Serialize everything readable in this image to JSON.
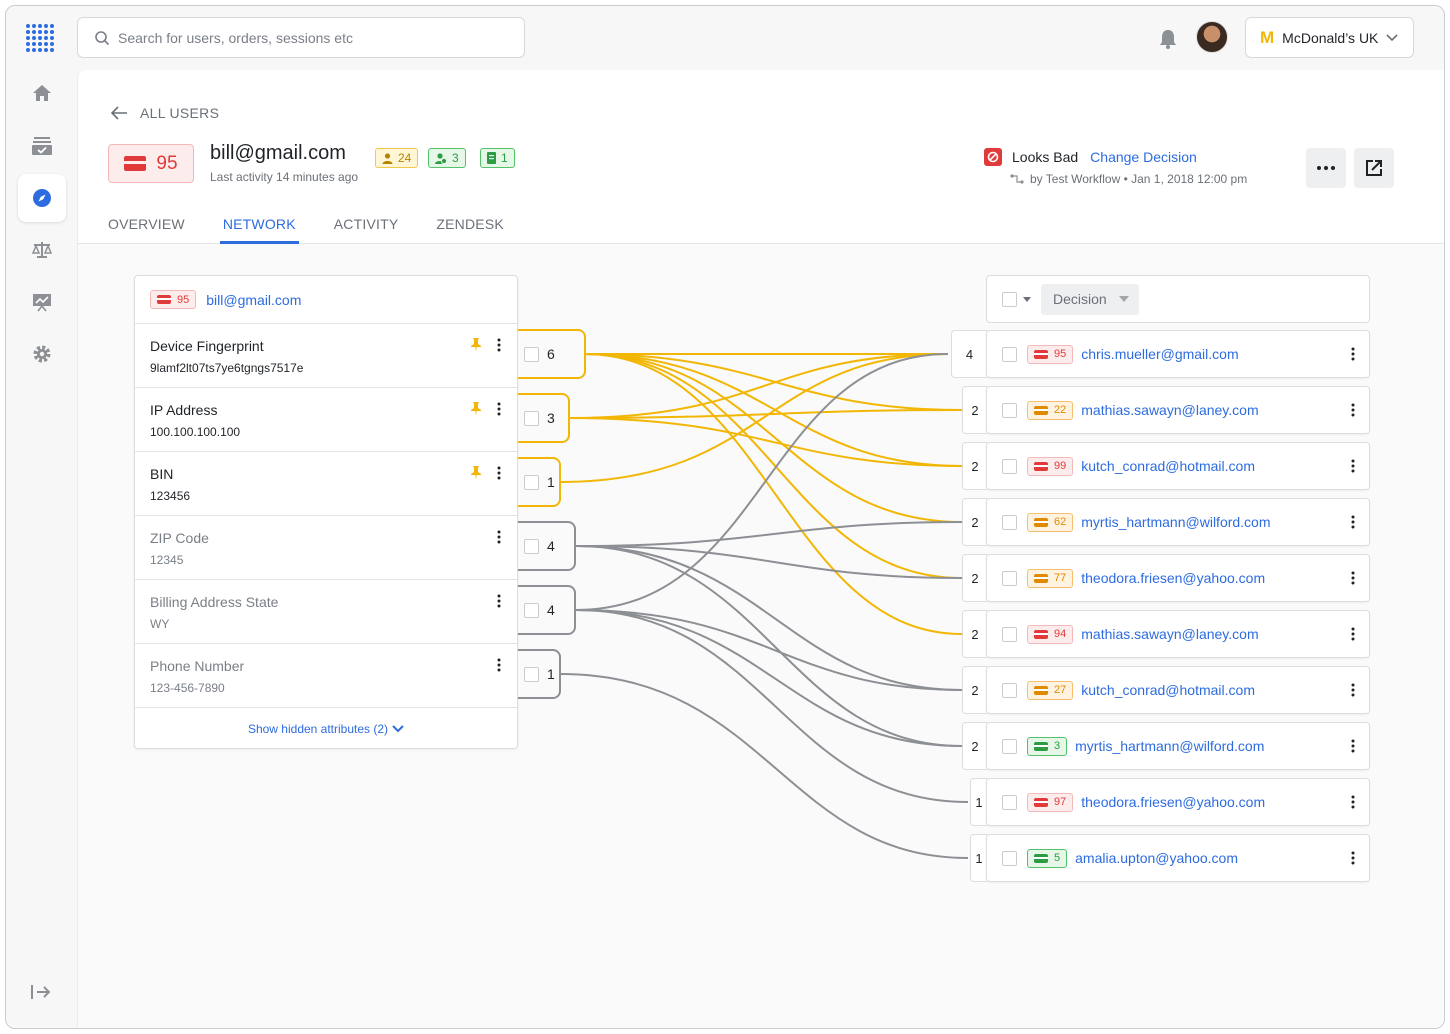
{
  "search": {
    "placeholder": "Search for users, orders, sessions etc"
  },
  "org": {
    "name": "McDonald’s UK"
  },
  "header": {
    "back_label": "ALL USERS",
    "score": "95",
    "user_email": "bill@gmail.com",
    "last_activity": "Last activity 14 minutes ago",
    "chips": [
      "24",
      "3",
      "1"
    ],
    "decision": "Looks Bad",
    "change_decision": "Change Decision",
    "byline": "by Test Workflow • Jan 1, 2018 12:00 pm",
    "tabs": [
      "OVERVIEW",
      "NETWORK",
      "ACTIVITY",
      "ZENDESK"
    ]
  },
  "panel": {
    "score": "95",
    "email": "bill@gmail.com",
    "attributes": [
      {
        "label": "Device Fingerprint",
        "value": "9lamf2lt07ts7ye6tgngs7517e",
        "pinned": true
      },
      {
        "label": "IP Address",
        "value": "100.100.100.100",
        "pinned": true
      },
      {
        "label": "BIN",
        "value": "123456",
        "pinned": true
      },
      {
        "label": "ZIP Code",
        "value": "12345",
        "pinned": false
      },
      {
        "label": "Billing Address State",
        "value": "WY",
        "pinned": false
      },
      {
        "label": "Phone Number",
        "value": "123-456-7890",
        "pinned": false
      }
    ],
    "show_hidden": "Show hidden attributes (2)"
  },
  "connectors": [
    "6",
    "3",
    "1",
    "4",
    "4",
    "1"
  ],
  "list_header": {
    "decision_label": "Decision"
  },
  "users": [
    {
      "count": "4",
      "score": "95",
      "email": "chris.mueller@gmail.com",
      "level": "red"
    },
    {
      "count": "2",
      "score": "22",
      "email": "mathias.sawayn@laney.com",
      "level": "orange"
    },
    {
      "count": "2",
      "score": "99",
      "email": "kutch_conrad@hotmail.com",
      "level": "red"
    },
    {
      "count": "2",
      "score": "62",
      "email": "myrtis_hartmann@wilford.com",
      "level": "orange"
    },
    {
      "count": "2",
      "score": "77",
      "email": "theodora.friesen@yahoo.com",
      "level": "orange"
    },
    {
      "count": "2",
      "score": "94",
      "email": "mathias.sawayn@laney.com",
      "level": "red"
    },
    {
      "count": "2",
      "score": "27",
      "email": "kutch_conrad@hotmail.com",
      "level": "orange"
    },
    {
      "count": "2",
      "score": "3",
      "email": "myrtis_hartmann@wilford.com",
      "level": "green"
    },
    {
      "count": "1",
      "score": "97",
      "email": "theodora.friesen@yahoo.com",
      "level": "red"
    },
    {
      "count": "1",
      "score": "5",
      "email": "amalia.upton@yahoo.com",
      "level": "green"
    }
  ],
  "colors": {
    "accent": "#2d6cdf",
    "link_yellow": "#f2b705",
    "link_gray": "#8c8f94",
    "bad": "#e03a3a"
  }
}
